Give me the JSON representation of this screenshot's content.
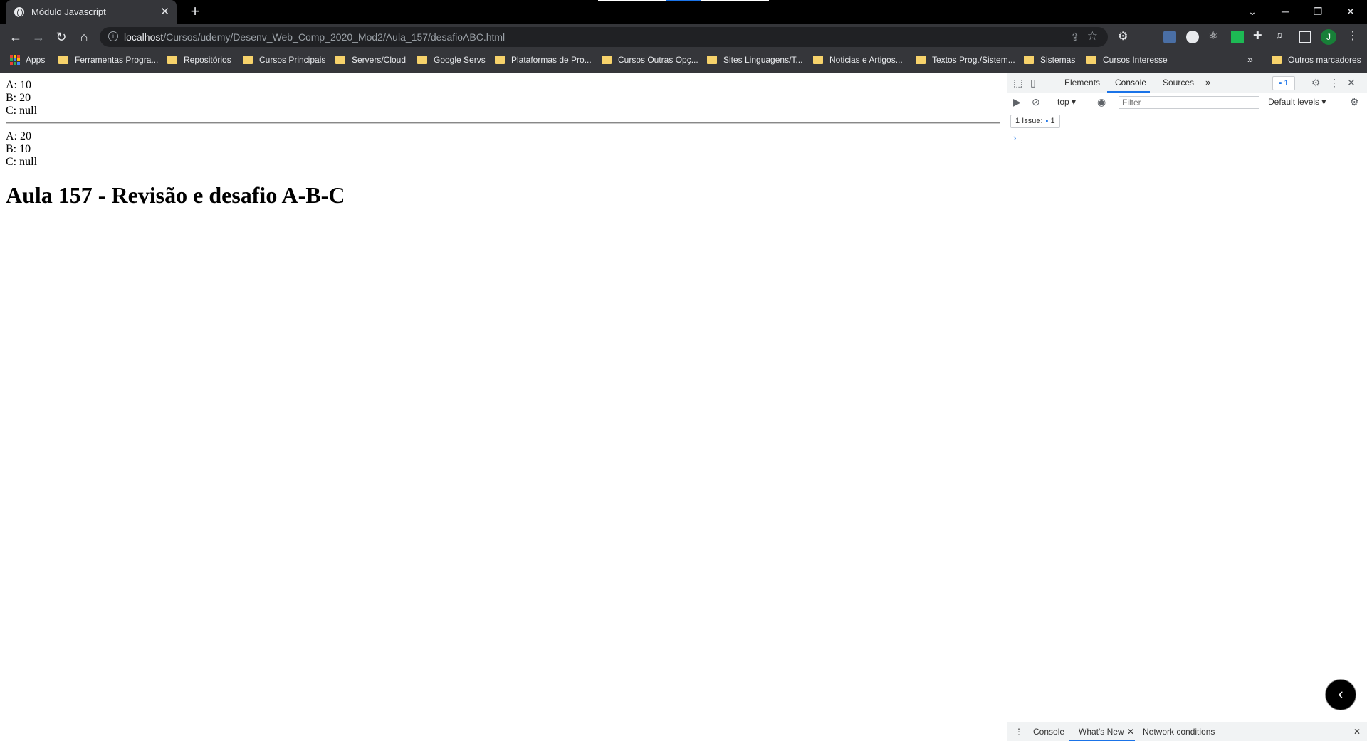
{
  "browser": {
    "tab_title": "Módulo Javascript",
    "tab_close": "✕",
    "new_tab": "+",
    "url_host": "localhost",
    "url_path": "/Cursos/udemy/Desenv_Web_Comp_2020_Mod2/Aula_157/desafioABC.html",
    "window_controls": [
      "⌄",
      "─",
      "❐",
      "✕"
    ],
    "avatar_letter": "J"
  },
  "bookmarks": {
    "apps": "Apps",
    "items": [
      "Ferramentas Progra...",
      "Repositórios",
      "Cursos Principais",
      "Servers/Cloud",
      "Google Servs",
      "Plataformas de Pro...",
      "Cursos Outras Opç...",
      "Sites Linguagens/T...",
      "Noticias e Artigos...",
      "Textos Prog./Sistem...",
      "Sistemas",
      "Cursos Interesse"
    ],
    "overflow": "»",
    "other": "Outros marcadores"
  },
  "page": {
    "first": [
      "A: 10",
      "B: 20",
      "C: null"
    ],
    "second": [
      "A: 20",
      "B: 10",
      "C: null"
    ],
    "heading": "Aula 157 - Revisão e desafio A-B-C"
  },
  "devtools": {
    "tabs": [
      "Elements",
      "Console",
      "Sources"
    ],
    "more_tabs": "»",
    "issues_badge": "1",
    "context": "top ▾",
    "filter_placeholder": "Filter",
    "levels": "Default levels ▾",
    "issues_label": "1 Issue:",
    "issues_count": "1",
    "prompt": "›",
    "drawer_tabs": [
      "Console",
      "What's New",
      "Network conditions"
    ],
    "drawer_close_tab": "✕"
  }
}
